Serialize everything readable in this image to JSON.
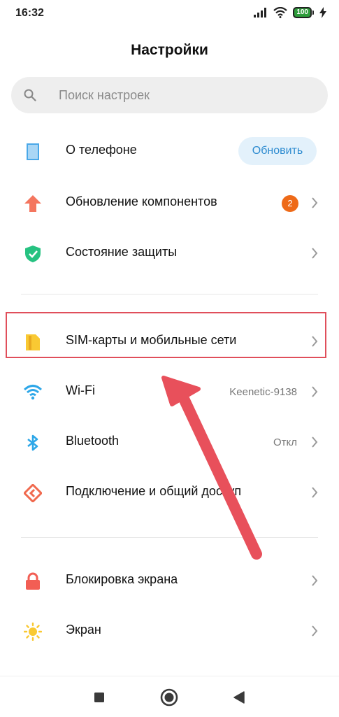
{
  "status_bar": {
    "time": "16:32",
    "battery_level": "100"
  },
  "header": {
    "title": "Настройки"
  },
  "search": {
    "placeholder": "Поиск настроек"
  },
  "items": [
    {
      "label": "О телефоне",
      "icon": "phone-icon",
      "action_label": "Обновить"
    },
    {
      "label": "Обновление компонентов",
      "icon": "arrow-up-icon",
      "badge": "2"
    },
    {
      "label": "Состояние защиты",
      "icon": "shield-check-icon"
    },
    {
      "label": "SIM-карты и мобильные сети",
      "icon": "sim-card-icon"
    },
    {
      "label": "Wi-Fi",
      "icon": "wifi-icon",
      "value": "Keenetic-9138"
    },
    {
      "label": "Bluetooth",
      "icon": "bluetooth-icon",
      "value": "Откл"
    },
    {
      "label": "Подключение и общий доступ",
      "icon": "connection-sharing-icon"
    },
    {
      "label": "Блокировка экрана",
      "icon": "lock-icon"
    },
    {
      "label": "Экран",
      "icon": "sun-icon"
    }
  ],
  "colors": {
    "highlight_box": "#e04f5b",
    "arrow": "#e8505b",
    "accent_blue": "#2d8bd0",
    "badge": "#ee6a18"
  },
  "navigation_bar": {
    "buttons": [
      "recent-apps-icon",
      "home-icon",
      "back-icon"
    ]
  }
}
